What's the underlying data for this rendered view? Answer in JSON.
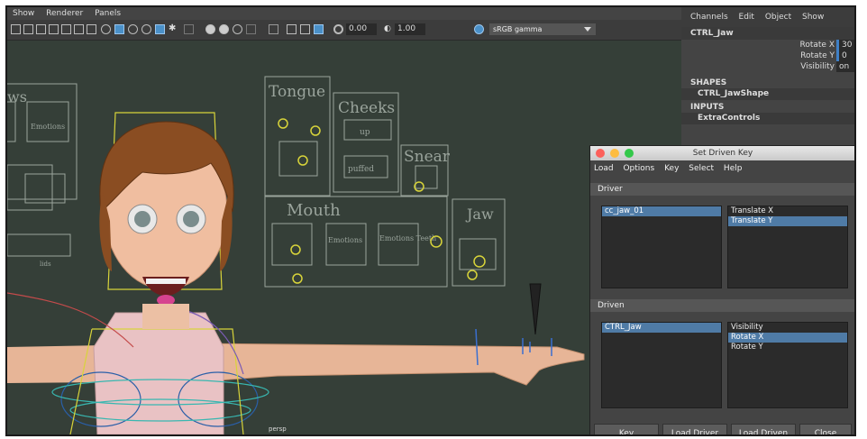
{
  "viewport": {
    "menu": [
      "Show",
      "Renderer",
      "Panels"
    ],
    "toolbar": {
      "field_a": "0.00",
      "field_b": "1.00",
      "color_space": "sRGB gamma"
    },
    "camera_label": "persp",
    "rig_labels": {
      "tongue": "Tongue",
      "cheeks": "Cheeks",
      "cheeks_up": "up",
      "cheeks_puffed": "puffed",
      "snear": "Snear",
      "mouth": "Mouth",
      "mouth_emotions": "Emotions",
      "mouth_emotions_teeth": "Emotions\nTeeth",
      "jaw": "Jaw",
      "brows": "ws",
      "brows_emotions": "Emotions",
      "lids": "lids"
    }
  },
  "channels": {
    "menu": [
      "Channels",
      "Edit",
      "Object",
      "Show"
    ],
    "object": "CTRL_Jaw",
    "attrs": [
      {
        "label": "Rotate X",
        "value": "30"
      },
      {
        "label": "Rotate Y",
        "value": "0"
      },
      {
        "label": "Visibility",
        "value": "on"
      }
    ],
    "shapes_header": "SHAPES",
    "shapes_item": "CTRL_JawShape",
    "inputs_header": "INPUTS",
    "inputs_item": "ExtraControls"
  },
  "dialog": {
    "title": "Set Driven Key",
    "menu": [
      "Load",
      "Options",
      "Key",
      "Select",
      "Help"
    ],
    "driver_header": "Driver",
    "driver_objects": [
      "cc_jaw_01"
    ],
    "driver_attrs": [
      "Translate X",
      "Translate Y"
    ],
    "driven_header": "Driven",
    "driven_objects": [
      "CTRL_Jaw"
    ],
    "driven_attrs": [
      "Visibility",
      "Rotate X",
      "Rotate Y"
    ],
    "buttons": {
      "key": "Key",
      "load_driver": "Load Driver",
      "load_driven": "Load Driven",
      "close": "Close"
    },
    "colors": {
      "close": "#fc605b",
      "minimize": "#fdbc40",
      "zoom": "#34c84a",
      "selection": "#4f7ba6"
    }
  }
}
